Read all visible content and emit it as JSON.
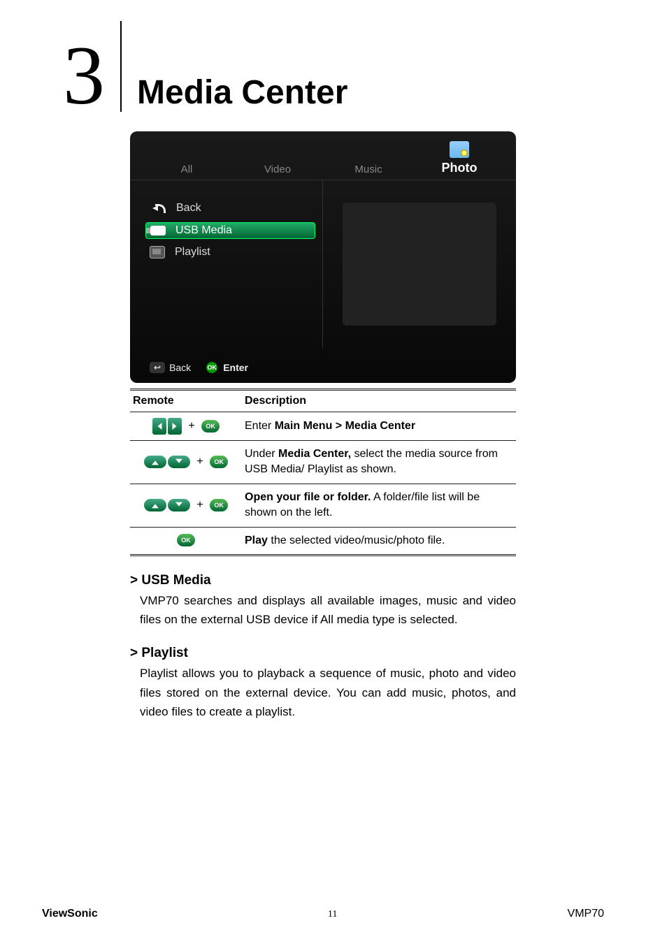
{
  "chapter": {
    "number": "3",
    "title": "Media Center"
  },
  "screenshot": {
    "tabs": {
      "t0": "All",
      "t1": "Video",
      "t2": "Music",
      "t3": "Photo"
    },
    "left_items": {
      "back": "Back",
      "usb": "USB Media",
      "playlist": "Playlist"
    },
    "hints": {
      "back_label": "Back",
      "ok_prefix": "OK",
      "enter": "Enter"
    }
  },
  "table": {
    "headers": {
      "c0": "Remote",
      "c1": "Description"
    },
    "ok_text": "OK",
    "plus": "+",
    "rows": {
      "r0": {
        "pre": "Enter ",
        "bold": "Main Menu > Media Center"
      },
      "r1": {
        "pre": "Under ",
        "bold": "Media Center,",
        "post": " select the media source from USB Media/ Playlist as shown."
      },
      "r2": {
        "bold": "Open your file or folder.",
        "post": " A folder/file list will be shown on the left."
      },
      "r3": {
        "bold": "Play",
        "post": " the selected video/music/photo file."
      }
    }
  },
  "sections": {
    "usb": {
      "heading": "> USB Media",
      "body": "VMP70 searches and displays all available images, music and video files on the external USB device if All media type is selected."
    },
    "playlist": {
      "heading": "> Playlist",
      "body": "Playlist allows you to playback a sequence of music, photo and video files stored on the external device. You can add music, photos, and video files to create a playlist."
    }
  },
  "footer": {
    "brand": "ViewSonic",
    "page_number": "11",
    "model": "VMP70"
  }
}
